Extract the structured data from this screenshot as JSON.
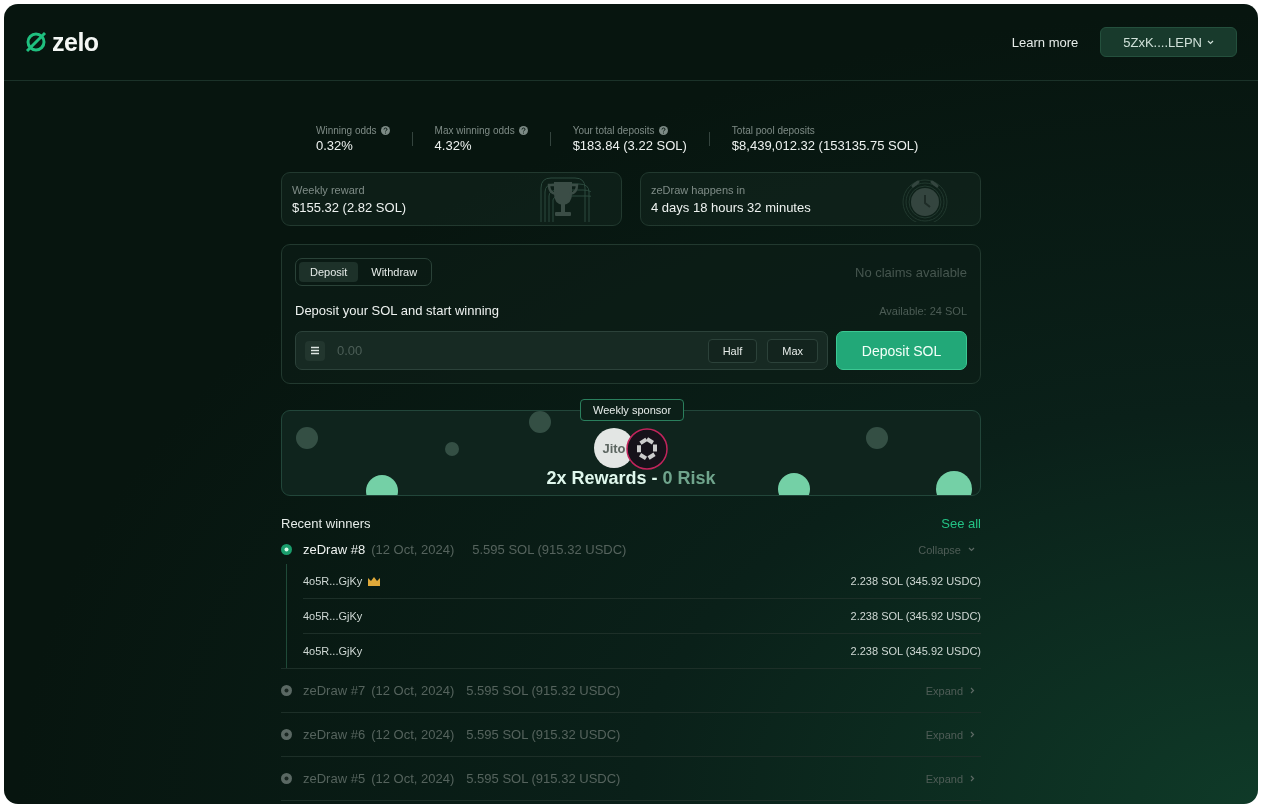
{
  "header": {
    "logo": "zelo",
    "learn_more": "Learn more",
    "wallet": "5ZxK....LEPN"
  },
  "stats": [
    {
      "label": "Winning odds",
      "value": "0.32%",
      "info": true
    },
    {
      "label": "Max winning odds",
      "value": "4.32%",
      "info": true
    },
    {
      "label": "Your total deposits",
      "value": "$183.84 (3.22 SOL)",
      "info": true
    },
    {
      "label": "Total pool deposits",
      "value": "$8,439,012.32 (153135.75 SOL)",
      "info": false
    }
  ],
  "cards": [
    {
      "kind": "trophy",
      "label": "Weekly reward",
      "value": "$155.32 (2.82 SOL)"
    },
    {
      "kind": "clock",
      "label": "zeDraw happens in",
      "value": "4 days 18 hours 32 minutes"
    }
  ],
  "panel": {
    "tabs": [
      {
        "label": "Deposit",
        "selected": true
      },
      {
        "label": "Withdraw",
        "selected": false
      }
    ],
    "claims": "No claims available",
    "heading": "Deposit your SOL and start winning",
    "available": "Available: 24 SOL",
    "amount_placeholder": "0.00",
    "half": "Half",
    "max": "Max",
    "submit": "Deposit SOL"
  },
  "sponsor": {
    "tag": "Weekly sponsor",
    "logo_text": "Jito",
    "headline_strong": "2x Rewards -",
    "headline_soft": "0 Risk"
  },
  "winners": {
    "title": "Recent winners",
    "see_all": "See all",
    "draws": [
      {
        "title": "zeDraw #8",
        "date": "(12 Oct, 2024)",
        "amount": "5.595 SOL (915.32 USDC)",
        "toggle": "Collapse",
        "expanded": true,
        "winners": [
          {
            "address": "4o5R...GjKy",
            "top": true,
            "amount": "2.238 SOL (345.92 USDC)"
          },
          {
            "address": "4o5R...GjKy",
            "top": false,
            "amount": "2.238 SOL (345.92 USDC)"
          },
          {
            "address": "4o5R...GjKy",
            "top": false,
            "amount": "2.238 SOL (345.92 USDC)"
          }
        ]
      },
      {
        "title": "zeDraw #7",
        "date": "(12 Oct, 2024)",
        "amount": "5.595 SOL (915.32 USDC)",
        "toggle": "Expand",
        "expanded": false
      },
      {
        "title": "zeDraw #6",
        "date": "(12 Oct, 2024)",
        "amount": "5.595 SOL (915.32 USDC)",
        "toggle": "Expand",
        "expanded": false
      },
      {
        "title": "zeDraw #5",
        "date": "(12 Oct, 2024)",
        "amount": "5.595 SOL (915.32 USDC)",
        "toggle": "Expand",
        "expanded": false
      }
    ]
  }
}
